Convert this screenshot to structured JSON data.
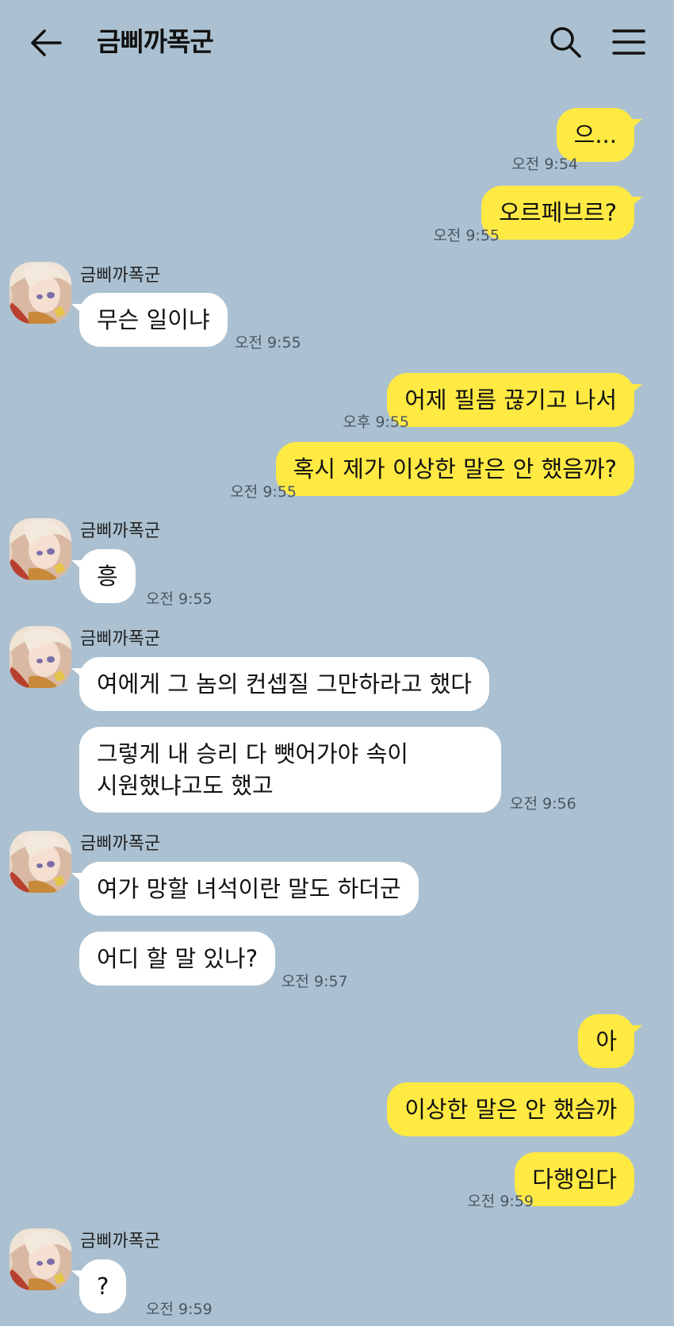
{
  "header": {
    "title": "금삐까폭군",
    "back_icon": "back-arrow-icon",
    "search_icon": "search-icon",
    "menu_icon": "hamburger-menu-icon"
  },
  "colors": {
    "background": "#abc1d1",
    "my_bubble": "#ffe943",
    "other_bubble": "#ffffff"
  },
  "sender_name": "금삐까폭군",
  "messages": [
    {
      "from": "me",
      "text": "으...",
      "time": "오전 9:54"
    },
    {
      "from": "me",
      "text": "오르페브르?",
      "time": "오전 9:55"
    },
    {
      "from": "other",
      "name": "금삐까폭군",
      "text": "무슨 일이냐",
      "time": "오전 9:55"
    },
    {
      "from": "me",
      "text": "어제 필름 끊기고 나서",
      "time": "오후 9:55"
    },
    {
      "from": "me",
      "text": "혹시 제가 이상한 말은 안 했음까?",
      "time": "오전 9:55"
    },
    {
      "from": "other",
      "name": "금삐까폭군",
      "text": "흥",
      "time": "오전 9:55"
    },
    {
      "from": "other",
      "name": "금삐까폭군",
      "text": "여에게 그 놈의 컨셉질 그만하라고 했다"
    },
    {
      "from": "other",
      "text_line1": "그렇게 내 승리 다 뺏어가야 속이",
      "text_line2": "시원했냐고도 했고",
      "time": "오전 9:56"
    },
    {
      "from": "other",
      "name": "금삐까폭군",
      "text": "여가 망할 녀석이란 말도 하더군"
    },
    {
      "from": "other",
      "text": "어디 할 말 있나?",
      "time": "오전 9:57"
    },
    {
      "from": "me",
      "text": "아"
    },
    {
      "from": "me",
      "text": "이상한 말은 안 했슴까"
    },
    {
      "from": "me",
      "text": "다행임다",
      "time": "오전 9:59"
    },
    {
      "from": "other",
      "name": "금삐까폭군",
      "text": "?",
      "time": "오전 9:59"
    }
  ]
}
